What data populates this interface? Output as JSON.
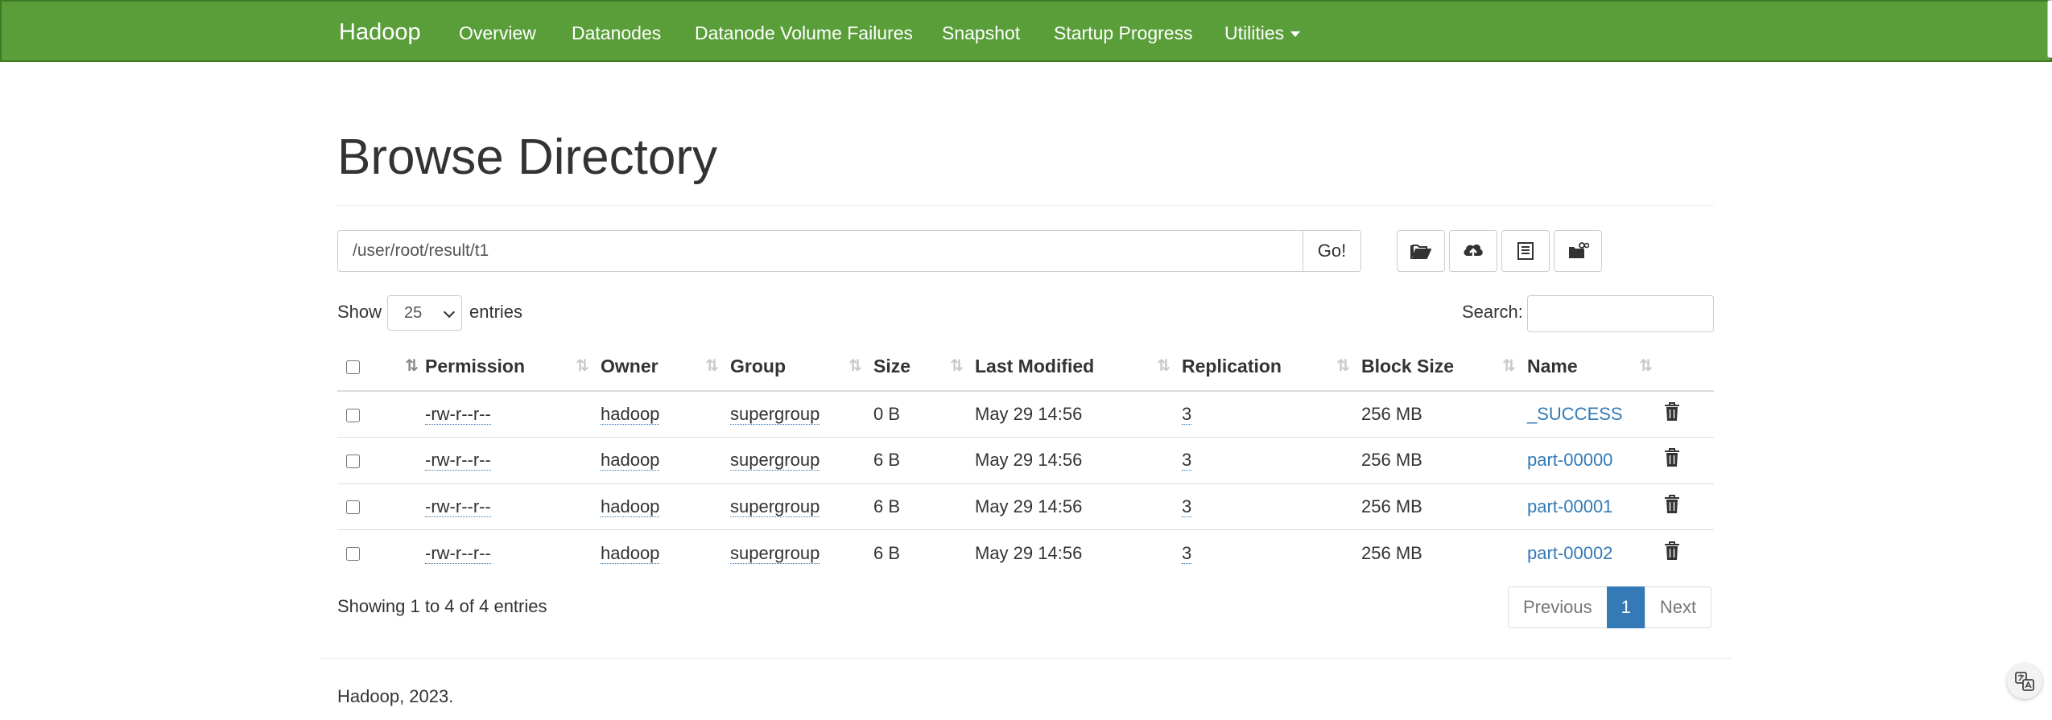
{
  "navbar": {
    "brand": "Hadoop",
    "items": [
      "Overview",
      "Datanodes",
      "Datanode Volume Failures",
      "Snapshot",
      "Startup Progress",
      "Utilities"
    ],
    "background_color": "#5a9e3a"
  },
  "page_title": "Browse Directory",
  "path_bar": {
    "value": "/user/root/result/t1",
    "go_label": "Go!"
  },
  "toolbar": {
    "icons": [
      "folder-open-icon",
      "cloud-upload-icon",
      "list-alt-icon",
      "folder-cut-paste-icon"
    ]
  },
  "length_control": {
    "show_label": "Show",
    "selected": "25",
    "entries_label": "entries"
  },
  "search": {
    "label": "Search:",
    "value": ""
  },
  "table": {
    "headers": [
      "Permission",
      "Owner",
      "Group",
      "Size",
      "Last Modified",
      "Replication",
      "Block Size",
      "Name"
    ],
    "rows": [
      {
        "permission": "-rw-r--r--",
        "owner": "hadoop",
        "group": "supergroup",
        "size": "0 B",
        "modified": "May 29 14:56",
        "replication": "3",
        "block_size": "256 MB",
        "name": "_SUCCESS"
      },
      {
        "permission": "-rw-r--r--",
        "owner": "hadoop",
        "group": "supergroup",
        "size": "6 B",
        "modified": "May 29 14:56",
        "replication": "3",
        "block_size": "256 MB",
        "name": "part-00000"
      },
      {
        "permission": "-rw-r--r--",
        "owner": "hadoop",
        "group": "supergroup",
        "size": "6 B",
        "modified": "May 29 14:56",
        "replication": "3",
        "block_size": "256 MB",
        "name": "part-00001"
      },
      {
        "permission": "-rw-r--r--",
        "owner": "hadoop",
        "group": "supergroup",
        "size": "6 B",
        "modified": "May 29 14:56",
        "replication": "3",
        "block_size": "256 MB",
        "name": "part-00002"
      }
    ]
  },
  "table_info": "Showing 1 to 4 of 4 entries",
  "pagination": {
    "previous": "Previous",
    "current": "1",
    "next": "Next"
  },
  "footer": "Hadoop, 2023.",
  "colors": {
    "link": "#337ab7",
    "active_page": "#337ab7"
  }
}
